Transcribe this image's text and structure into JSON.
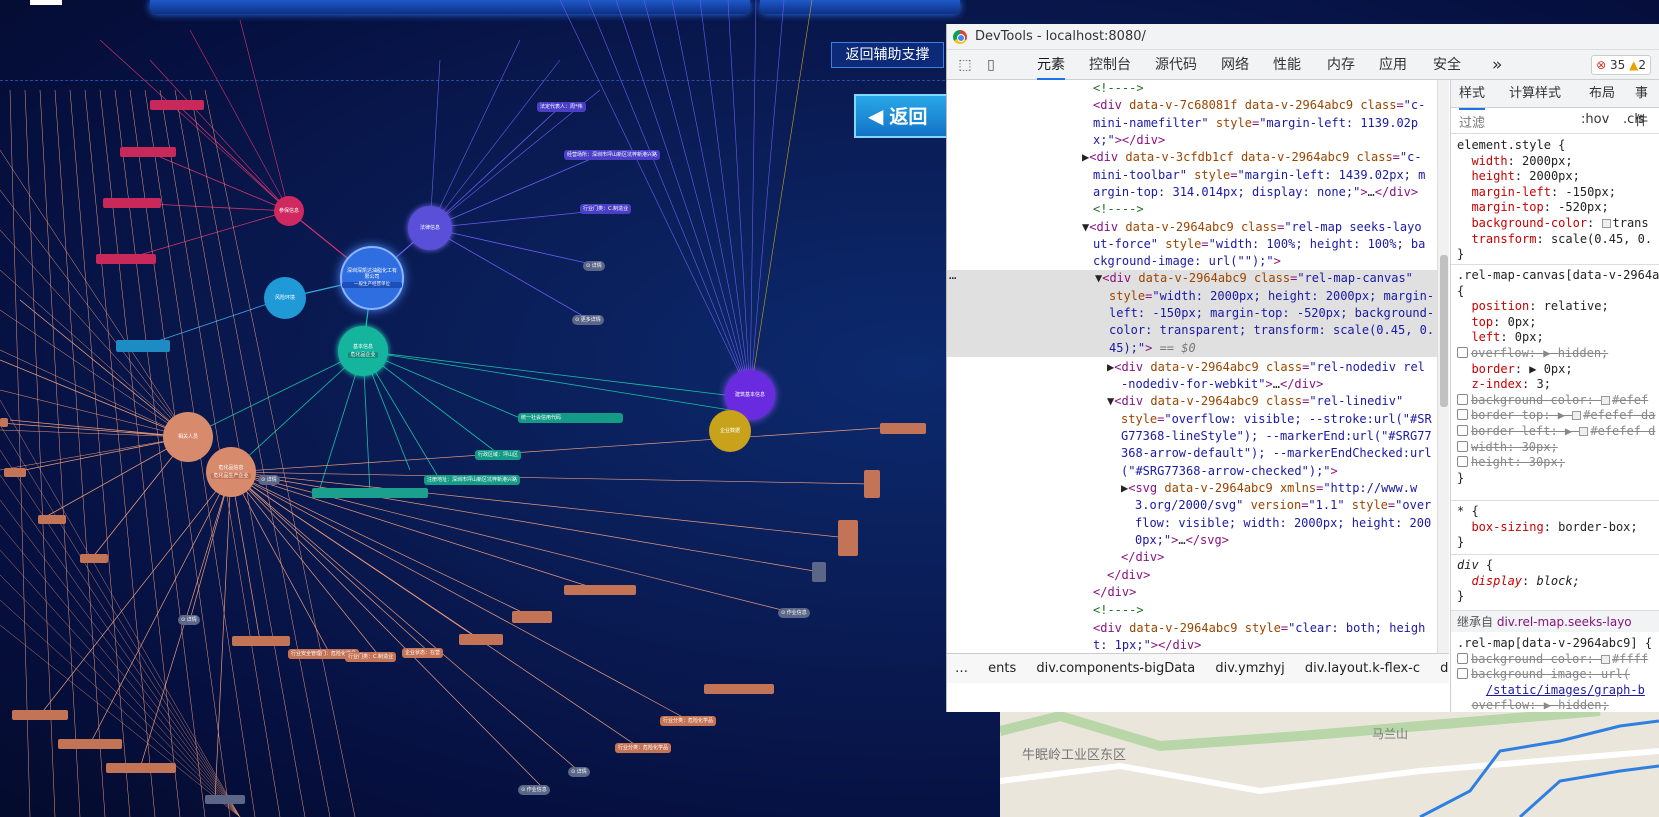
{
  "graph": {
    "back_assist_label": "返回辅助支撑",
    "back_label": "返回",
    "company_name": "深圳深凯达油脂化工有限公司",
    "company_sub": "一般生产经营单位",
    "nodes": {
      "law": "法律信息",
      "party": "参保信息",
      "risk": "风险环境",
      "basic": "基本信息",
      "basic_sub": "危化品企业",
      "hazard": "危化品信息",
      "hazard_sub": "危化品生产企业",
      "people": "相关人员",
      "plan": "建筑基本信息",
      "company_data": "企业数据"
    },
    "tags": {
      "legal_rep": "法定代表人：周*伟",
      "reg_addr": "经营场所：深圳市坪山新区坑梓新港兴路",
      "industry": "行业门类：C.制造业",
      "detail": "⊙ 详情",
      "more": "⊙ 更多详情",
      "credit": "统一社会信用代码",
      "region": "行政区域：坪山区",
      "address": "注册地址：深圳市坪山新区坑梓新港兴路",
      "work_info": "⊙ 作业信息",
      "industry_branch": "行业分类：危险化学品",
      "safety_prod": "行业安全管理门：危险化学品",
      "enterprise_status": "企业状态：在营",
      "tag_c": "行业门类：C.制造业"
    }
  },
  "devtools": {
    "title": "DevTools - localhost:8080/",
    "tabs": [
      "元素",
      "控制台",
      "源代码",
      "网络",
      "性能",
      "内存",
      "应用",
      "安全"
    ],
    "more": "»",
    "errors": "35",
    "warnings": "2",
    "styles_tabs": [
      "样式",
      "计算样式",
      "布局",
      "事件"
    ],
    "filter_placeholder": "过滤",
    "hov": ":hov",
    "cls": ".cls",
    "breadcrumb": [
      "…",
      "ents",
      "div.components-bigData",
      "div.ymzhyj",
      "div.layout.k-flex-c",
      "div.layer",
      "…"
    ],
    "eq0": "== $0",
    "inherited_label": "继承自",
    "inherited_sel": "div.rel-map.seeks-layo"
  },
  "map": {
    "place1": "牛眠岭工业区东区",
    "place2": "马兰山"
  }
}
